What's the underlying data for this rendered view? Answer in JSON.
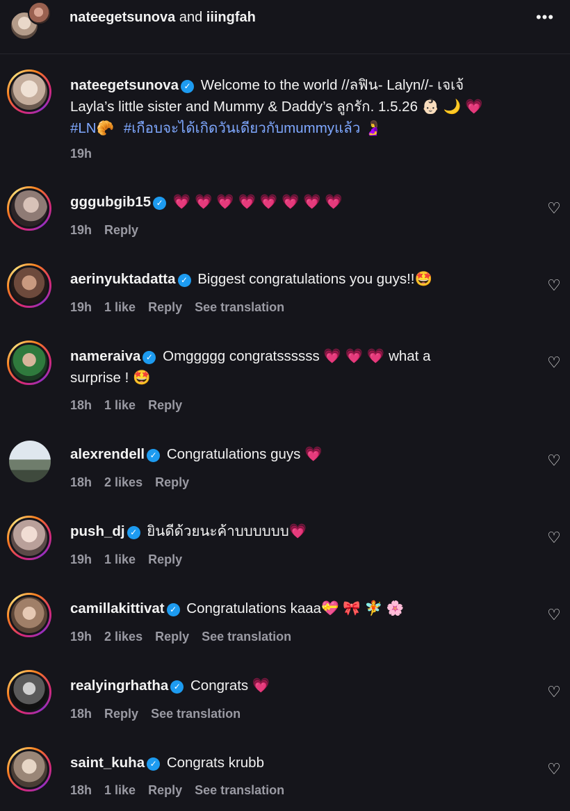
{
  "header": {
    "user1": "nateegetsunova",
    "conj": "and",
    "user2": "iiingfah",
    "more": "•••"
  },
  "caption": {
    "username": "nateegetsunova",
    "line1": "Welcome to the world //ลฟิน- Lalyn//- เจเจ้",
    "line2": "Layla’s little sister and Mummy & Daddy’s ลูกรัก. 1.5.26 👶🏻 🌙 💗",
    "hashtag1": "#LN",
    "hashtag1_emoji": "🥐",
    "hashtag2": "#เกือบจะได้เกิดวันเดียวกับmummyแล้ว",
    "hashtag2_emoji": "🤰",
    "time": "19h"
  },
  "comments": [
    {
      "username": "gggubgib15",
      "text": "💗 💗 💗 💗 💗 💗 💗 💗",
      "time": "19h",
      "likes": "",
      "reply": "Reply",
      "translation": ""
    },
    {
      "username": "aerinyuktadatta",
      "text": "Biggest congratulations you guys!!🤩",
      "time": "19h",
      "likes": "1 like",
      "reply": "Reply",
      "translation": "See translation"
    },
    {
      "username": "nameraiva",
      "text": "Omggggg congratssssss 💗 💗 💗  what a",
      "text2": "surprise ! 🤩",
      "time": "18h",
      "likes": "1 like",
      "reply": "Reply",
      "translation": ""
    },
    {
      "username": "alexrendell",
      "text": "Congratulations guys  💗",
      "time": "18h",
      "likes": "2 likes",
      "reply": "Reply",
      "translation": ""
    },
    {
      "username": "push_dj",
      "text": "ยินดีด้วยนะค้าบบบบบบ💗",
      "time": "19h",
      "likes": "1 like",
      "reply": "Reply",
      "translation": ""
    },
    {
      "username": "camillakittivat",
      "text": "Congratulations kaaa💝  🎀  🧚  🌸",
      "time": "19h",
      "likes": "2 likes",
      "reply": "Reply",
      "translation": "See translation"
    },
    {
      "username": "realyingrhatha",
      "text": "Congrats  💗",
      "time": "18h",
      "likes": "",
      "reply": "Reply",
      "translation": "See translation"
    },
    {
      "username": "saint_kuha",
      "text": "Congrats krubb",
      "time": "18h",
      "likes": "1 like",
      "reply": "Reply",
      "translation": "See translation"
    }
  ],
  "icons": {
    "verified": "✓",
    "heart_outline": "♡"
  },
  "colors": {
    "background": "#15151b",
    "hashtag": "#7fa8ff",
    "meta": "#9a9aa3",
    "verified": "#1d9bf0"
  }
}
